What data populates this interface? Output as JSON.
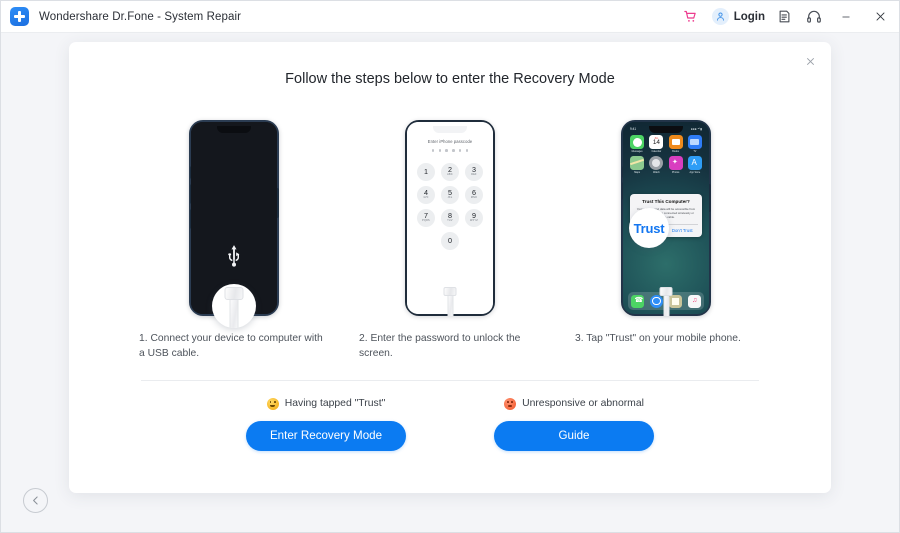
{
  "window": {
    "title": "Wondershare Dr.Fone - System Repair",
    "logo_icon": "cross-logo-icon",
    "titlebar_icons": [
      {
        "name": "cart-icon",
        "glyph": "cart"
      },
      {
        "name": "account-icon",
        "glyph": "person"
      },
      {
        "name": "feedback-icon",
        "glyph": "note"
      },
      {
        "name": "support-icon",
        "glyph": "headset"
      }
    ],
    "login_label": "Login",
    "minimize_label": "—",
    "close_label": "✕"
  },
  "modal": {
    "title": "Follow the steps below to enter the Recovery Mode",
    "close_label": "✕"
  },
  "steps": [
    {
      "id": "connect",
      "caption": "1. Connect your device to computer with a USB cable.",
      "phone": {
        "kind": "dark-usb-screen",
        "usb_icon": "usb-trident-icon"
      }
    },
    {
      "id": "passcode",
      "caption": "2. Enter the password to unlock the screen.",
      "phone": {
        "kind": "passcode-screen",
        "prompt": "Enter iPhone passcode",
        "dot_count": 6,
        "keys": [
          {
            "digit": "1",
            "letters": ""
          },
          {
            "digit": "2",
            "letters": "ABC"
          },
          {
            "digit": "3",
            "letters": "DEF"
          },
          {
            "digit": "4",
            "letters": "GHI"
          },
          {
            "digit": "5",
            "letters": "JKL"
          },
          {
            "digit": "6",
            "letters": "MNO"
          },
          {
            "digit": "7",
            "letters": "PQRS"
          },
          {
            "digit": "8",
            "letters": "TUV"
          },
          {
            "digit": "9",
            "letters": "WXYZ"
          },
          {
            "digit": "0",
            "letters": ""
          }
        ]
      }
    },
    {
      "id": "trust",
      "caption": "3. Tap \"Trust\" on your mobile phone.",
      "phone": {
        "kind": "home-screen",
        "status_time": "9:41",
        "status_right": "●●● ᵜᴵ ▮",
        "apps": [
          {
            "name": "messages",
            "label": "Messages",
            "color": "#4cd364"
          },
          {
            "name": "calendar",
            "label": "Calendar",
            "month": "JUL",
            "day": "14"
          },
          {
            "name": "books",
            "label": "Books",
            "color": "#f08a1c"
          },
          {
            "name": "tv",
            "label": "TV",
            "color": "#2e7cf6"
          },
          {
            "name": "maps",
            "label": "Maps",
            "color": "#8cc98f"
          },
          {
            "name": "watch",
            "label": "Watch",
            "color": "#9aa0a6"
          },
          {
            "name": "photos",
            "label": "Photos",
            "color": "#d93ec0"
          },
          {
            "name": "appstore",
            "label": "App Store",
            "color": "#2e9df6"
          }
        ],
        "dock": [
          {
            "name": "phone",
            "color": "#4cd364"
          },
          {
            "name": "safari",
            "color": "#2e8ef7"
          },
          {
            "name": "mail",
            "color": "#c9c49a"
          },
          {
            "name": "music",
            "color": "#f7f7f8"
          }
        ],
        "dialog": {
          "title": "Trust This Computer?",
          "body": "Your settings and data will be accessible from this computer when connected wirelessly or using a cable.",
          "primary": "Trust",
          "secondary": "Don't Trust"
        },
        "zoom_label": "Trust"
      }
    }
  ],
  "footer": {
    "options": [
      {
        "id": "tapped-trust",
        "emoji_icon": "happy-face-icon",
        "emoji_kind": "happy",
        "label": "Having tapped \"Trust\"",
        "button": "Enter Recovery Mode"
      },
      {
        "id": "unresponsive",
        "emoji_icon": "dizzy-face-icon",
        "emoji_kind": "dizzy",
        "label": "Unresponsive or abnormal",
        "button": "Guide"
      }
    ]
  },
  "nav": {
    "back_icon": "arrow-left-icon"
  },
  "colors": {
    "accent": "#0b7bf2",
    "app_bg": "#f4f5f8",
    "card": "#ffffff",
    "cart": "#ec3b8e",
    "text": "#3c424a"
  }
}
